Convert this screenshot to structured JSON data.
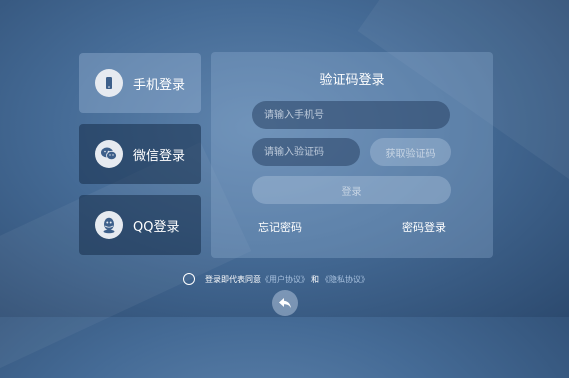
{
  "tabs": [
    {
      "label": "手机登录",
      "icon": "phone-icon",
      "active": true
    },
    {
      "label": "微信登录",
      "icon": "wechat-icon",
      "active": false
    },
    {
      "label": "QQ登录",
      "icon": "qq-icon",
      "active": false
    }
  ],
  "panel": {
    "title": "验证码登录",
    "phone_placeholder": "请输入手机号",
    "code_placeholder": "请输入验证码",
    "get_code_label": "获取验证码",
    "login_label": "登录",
    "forgot_label": "忘记密码",
    "password_login_label": "密码登录"
  },
  "agreement": {
    "prefix": "登录即代表同意",
    "user_agreement": "《用户协议》",
    "and": "和",
    "privacy_agreement": "《隐私协议》"
  },
  "back_icon": "back-arrow-icon"
}
